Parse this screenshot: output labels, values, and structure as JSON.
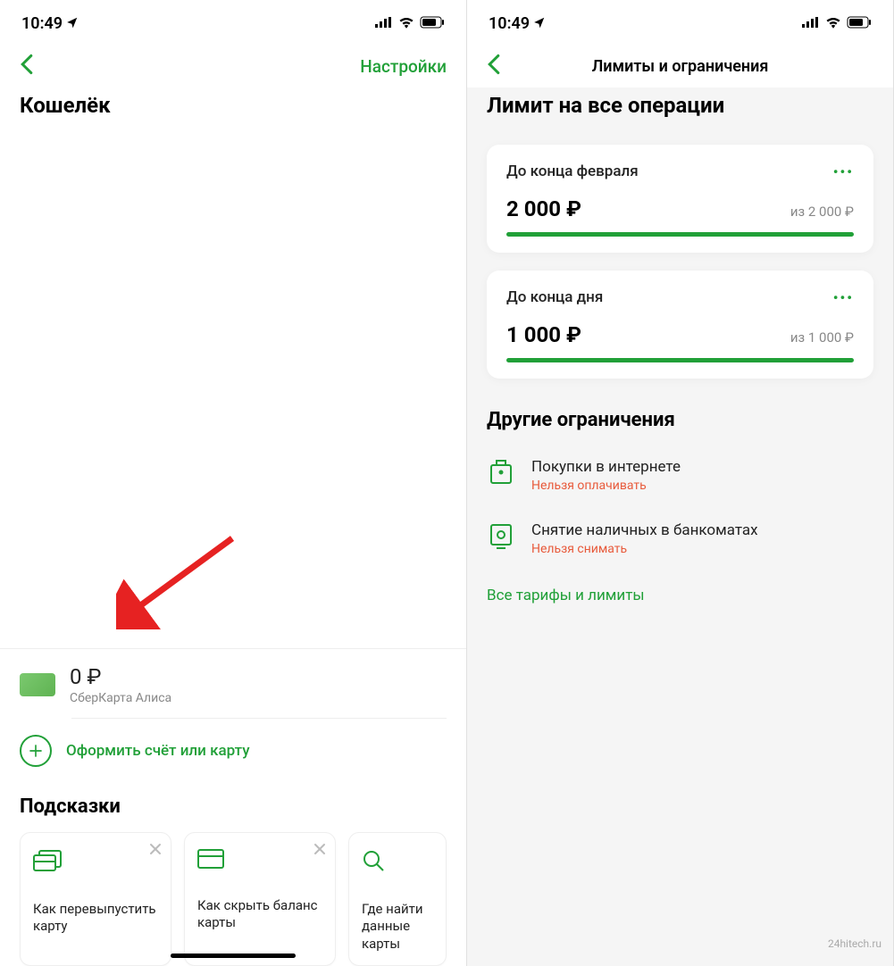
{
  "status": {
    "time": "10:49"
  },
  "left": {
    "nav_action": "Настройки",
    "page_title": "Кошелёк",
    "card": {
      "balance": "0 ₽",
      "name": "СберКарта Алиса"
    },
    "add_label": "Оформить счёт или карту",
    "tips_title": "Подсказки",
    "tips": [
      {
        "text": "Как перевыпустить карту"
      },
      {
        "text": "Как скрыть баланс карты"
      },
      {
        "text": "Где найти данные карты"
      }
    ]
  },
  "right": {
    "nav_title": "Лимиты и ограничения",
    "section_title": "Лимит на все операции",
    "limits": [
      {
        "period": "До конца февраля",
        "current": "2 000 ₽",
        "total": "из 2 000 ₽"
      },
      {
        "period": "До конца дня",
        "current": "1 000 ₽",
        "total": "из 1 000 ₽"
      }
    ],
    "other_title": "Другие ограничения",
    "restrictions": [
      {
        "label": "Покупки в интернете",
        "status": "Нельзя оплачивать"
      },
      {
        "label": "Снятие наличных в банкоматах",
        "status": "Нельзя снимать"
      }
    ],
    "all_tariffs": "Все тарифы и лимиты"
  },
  "watermark": "24hitech.ru"
}
